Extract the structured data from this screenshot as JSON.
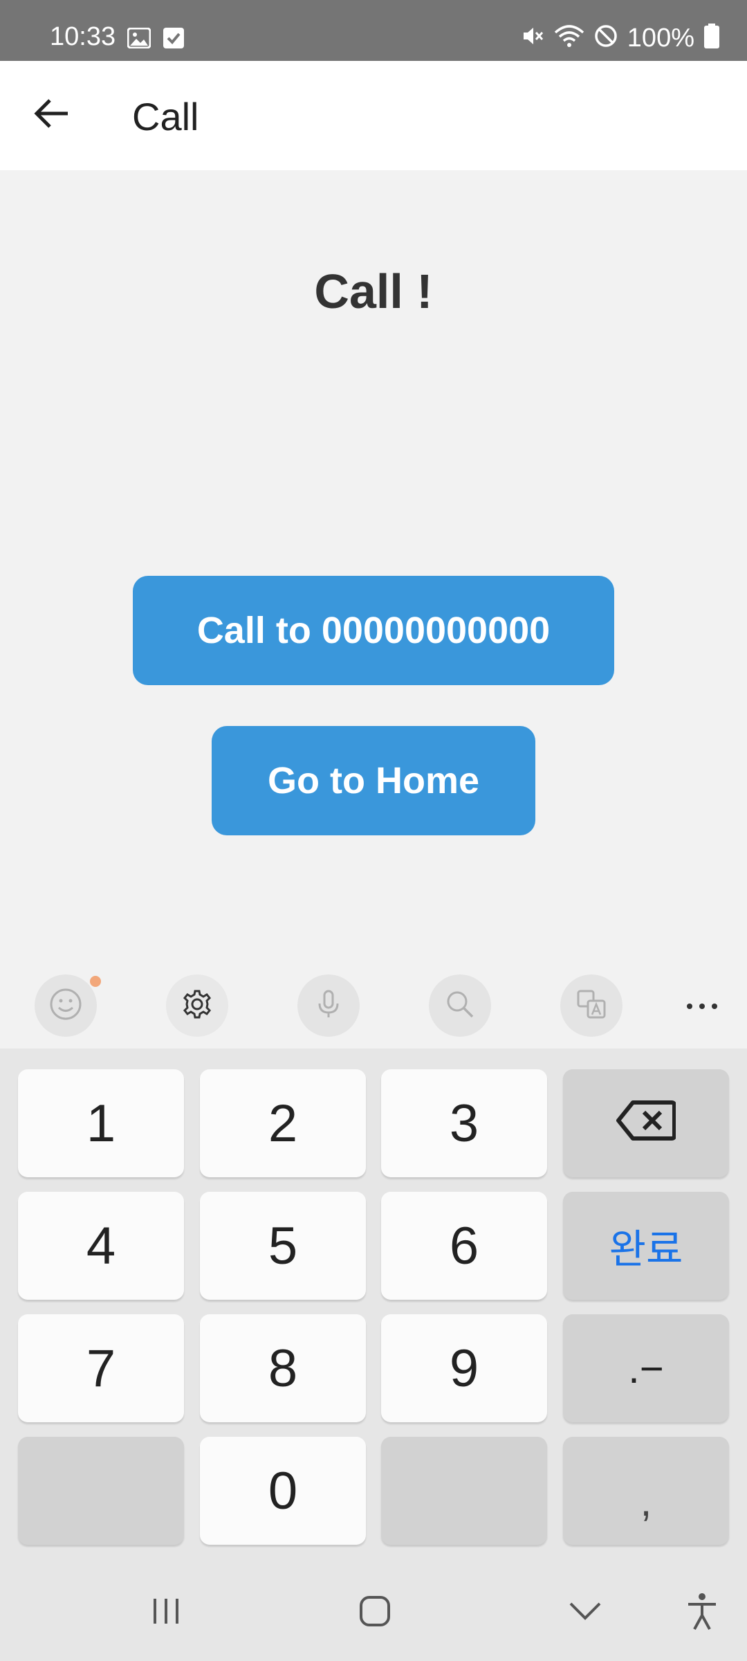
{
  "status_bar": {
    "time": "10:33",
    "battery": "100%",
    "icons": [
      "gallery-icon",
      "checkbox-icon",
      "mute-icon",
      "wifi-icon",
      "do-not-disturb-icon",
      "battery-icon"
    ]
  },
  "app_bar": {
    "back_icon": "arrow-left-icon",
    "title": "Call"
  },
  "main": {
    "heading": "Call !",
    "call_button": "Call to 00000000000",
    "home_button": "Go to Home"
  },
  "keyboard": {
    "toolbar": [
      "emoji-icon",
      "settings-icon",
      "microphone-icon",
      "search-icon",
      "translate-icon",
      "more-icon"
    ],
    "keys": {
      "k1": "1",
      "k2": "2",
      "k3": "3",
      "k4": "4",
      "k5": "5",
      "k6": "6",
      "k7": "7",
      "k8": "8",
      "k9": "9",
      "k0": "0",
      "done": "완료",
      "dot_dash": ".−",
      "comma": ","
    }
  },
  "colors": {
    "accent": "#3a97db",
    "status_bar": "#757575",
    "done_key_text": "#1a73e8"
  }
}
